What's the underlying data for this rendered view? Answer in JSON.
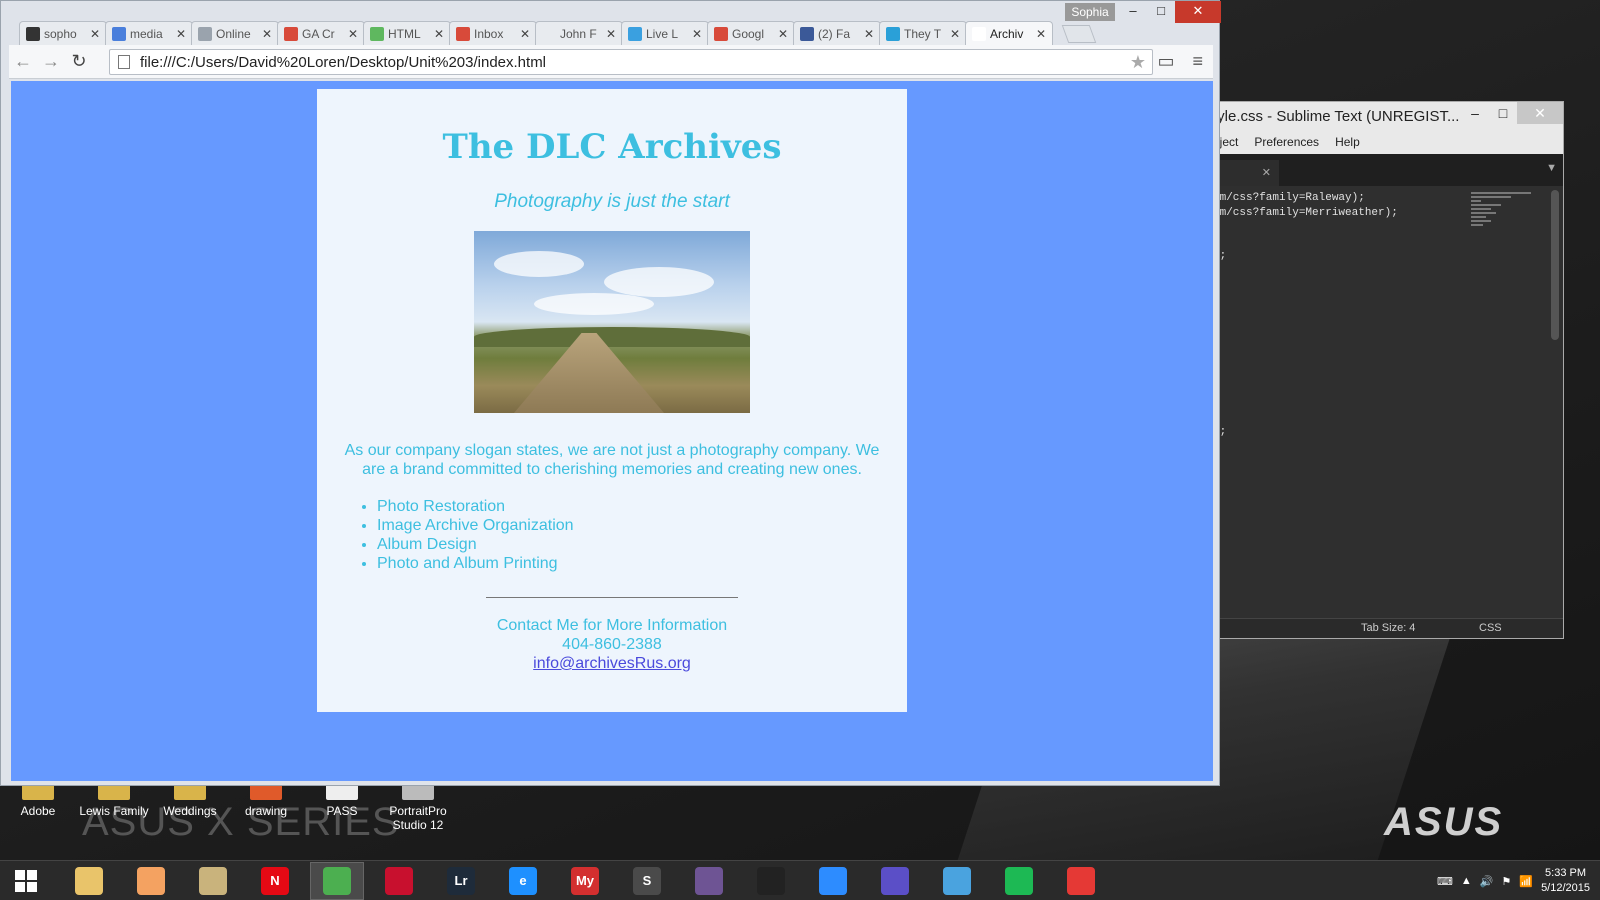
{
  "browser": {
    "profile_name": "Sophia",
    "url": "file:///C:/Users/David%20Loren/Desktop/Unit%203/index.html",
    "tabs": [
      {
        "label": "sopho",
        "fav_color": "#333333"
      },
      {
        "label": "media",
        "fav_color": "#4a7fdc"
      },
      {
        "label": "Online",
        "fav_color": "#9aa3ad"
      },
      {
        "label": "GA Cr",
        "fav_color": "#d84a3a"
      },
      {
        "label": "HTML",
        "fav_color": "#5fb85f"
      },
      {
        "label": "Inbox",
        "fav_color": "#d84a3a"
      },
      {
        "label": "John F",
        "fav_color": "#e8ebef"
      },
      {
        "label": "Live L",
        "fav_color": "#3aa0e0"
      },
      {
        "label": "Googl",
        "fav_color": "#d84a3a"
      },
      {
        "label": "(2) Fa",
        "fav_color": "#3b5998"
      },
      {
        "label": "They T",
        "fav_color": "#2aa0d8"
      },
      {
        "label": "Archiv",
        "fav_color": "#ffffff"
      }
    ],
    "tab_close": "✕"
  },
  "page": {
    "title": "The DLC Archives",
    "slogan": "Photography is just the start",
    "intro": "As our company slogan states, we are not just a photography company. We are a brand committed to cherishing memories and creating new ones.",
    "services": [
      "Photo Restoration",
      "Image Archive Organization",
      "Album Design",
      "Photo and Album Printing"
    ],
    "contact_heading": "Contact Me for More Information",
    "phone": "404-860-2388",
    "email": "info@archivesRus.org",
    "colors": {
      "background": "#6699ff",
      "card": "#eef5fd",
      "text": "#3dbfe0",
      "link": "#4a4adc"
    }
  },
  "sublime": {
    "title": "tyle.css - Sublime Text (UNREGIST...",
    "menu": [
      "oject",
      "Preferences",
      "Help"
    ],
    "code_lines": [
      "om/css?family=Raleway);",
      "om/css?family=Merriweather);",
      "f;",
      "f;"
    ],
    "status_tab_size": "Tab Size: 4",
    "status_syntax": "CSS"
  },
  "desktop": {
    "icons": [
      {
        "label": "Adobe"
      },
      {
        "label": "Lewis Family"
      },
      {
        "label": "Weddings"
      },
      {
        "label": "drawing"
      },
      {
        "label": "PASS"
      },
      {
        "label": "PortraitPro Studio 12"
      }
    ],
    "wallpaper_text": "ASUS X SERIES",
    "brand": "ASUS"
  },
  "taskbar": {
    "apps": [
      {
        "name": "file-explorer",
        "color": "#e9c46a"
      },
      {
        "name": "picasa",
        "color": "#f4a261"
      },
      {
        "name": "scanner",
        "color": "#c9b37c"
      },
      {
        "name": "netflix",
        "color": "#e50914",
        "glyph": "N"
      },
      {
        "name": "chrome",
        "color": "#4caf50"
      },
      {
        "name": "adobe-cc",
        "color": "#c8102e"
      },
      {
        "name": "lightroom",
        "color": "#1e2b3a",
        "glyph": "Lr"
      },
      {
        "name": "internet-explorer",
        "color": "#1e90ff",
        "glyph": "e"
      },
      {
        "name": "myheritage",
        "color": "#d32f2f",
        "glyph": "My"
      },
      {
        "name": "sublime-text",
        "color": "#4a4a4a",
        "glyph": "S"
      },
      {
        "name": "github",
        "color": "#6e5494"
      },
      {
        "name": "inkscape",
        "color": "#222222"
      },
      {
        "name": "zoom",
        "color": "#2d8cff"
      },
      {
        "name": "settings",
        "color": "#5b4fc7"
      },
      {
        "name": "network",
        "color": "#4aa3df"
      },
      {
        "name": "spotify",
        "color": "#1db954"
      },
      {
        "name": "chrome-2",
        "color": "#e53935"
      }
    ],
    "time": "5:33 PM",
    "date": "5/12/2015"
  }
}
